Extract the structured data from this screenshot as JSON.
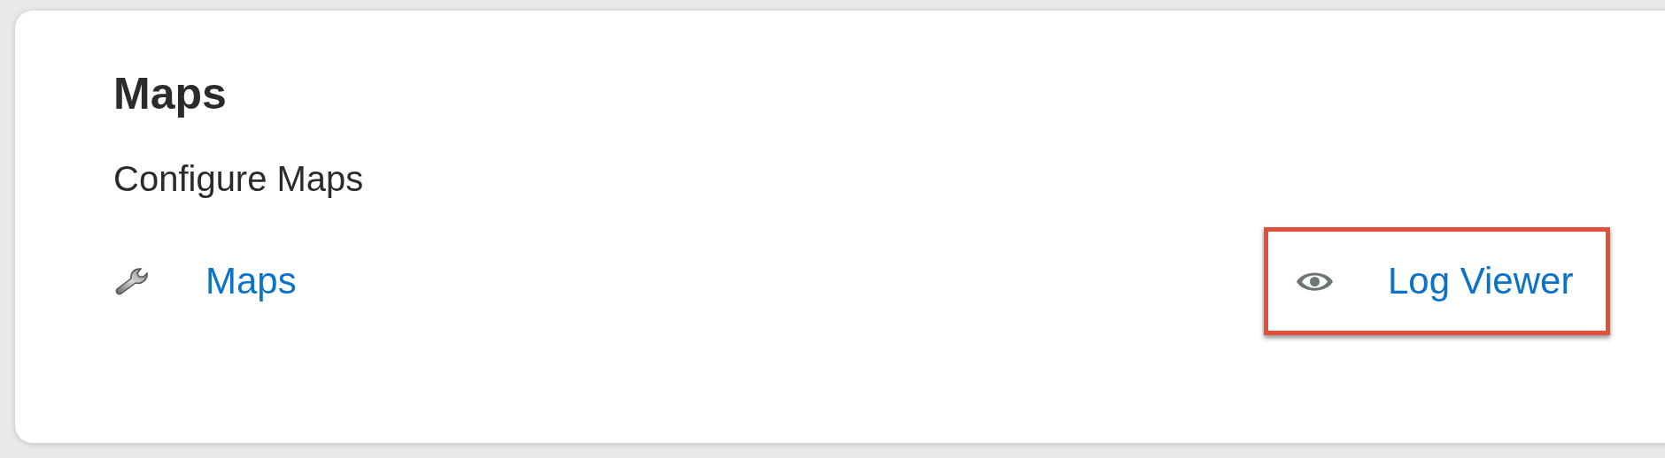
{
  "section": {
    "title": "Maps",
    "description": "Configure Maps",
    "links": [
      {
        "kind": "wrench",
        "label": "Maps",
        "highlighted": false
      },
      {
        "kind": "eye",
        "label": "Log Viewer",
        "highlighted": true
      }
    ]
  }
}
